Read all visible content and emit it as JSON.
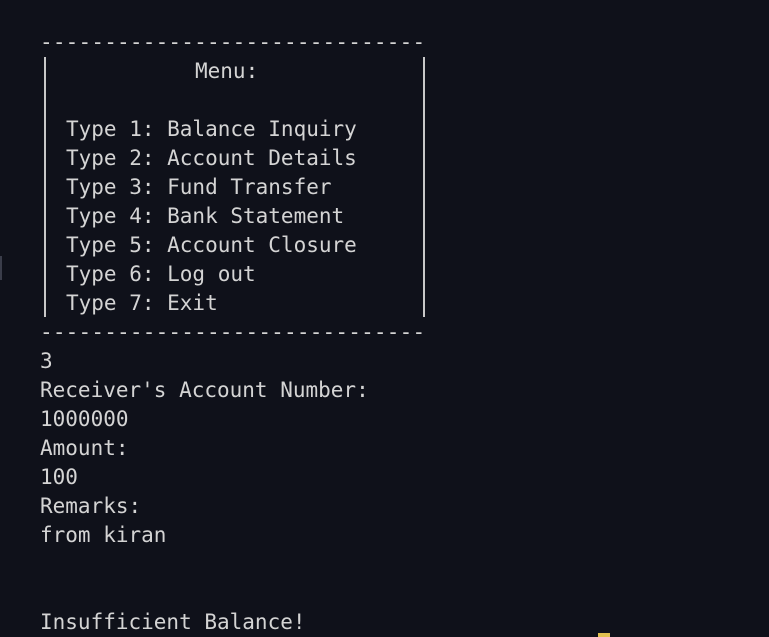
{
  "menu": {
    "top_border": "------------------------------",
    "bottom_border": "------------------------------",
    "title": "Menu:",
    "items": [
      "Type 1: Balance Inquiry",
      "Type 2: Account Details",
      "Type 3: Fund Transfer",
      "Type 4: Bank Statement",
      "Type 5: Account Closure",
      "Type 6: Log out",
      "Type 7: Exit"
    ]
  },
  "session": {
    "lines": [
      "3",
      "Receiver's Account Number:",
      "1000000",
      "Amount:",
      "100",
      "Remarks:",
      "from kiran",
      "",
      ""
    ],
    "result": "Insufficient Balance!"
  }
}
